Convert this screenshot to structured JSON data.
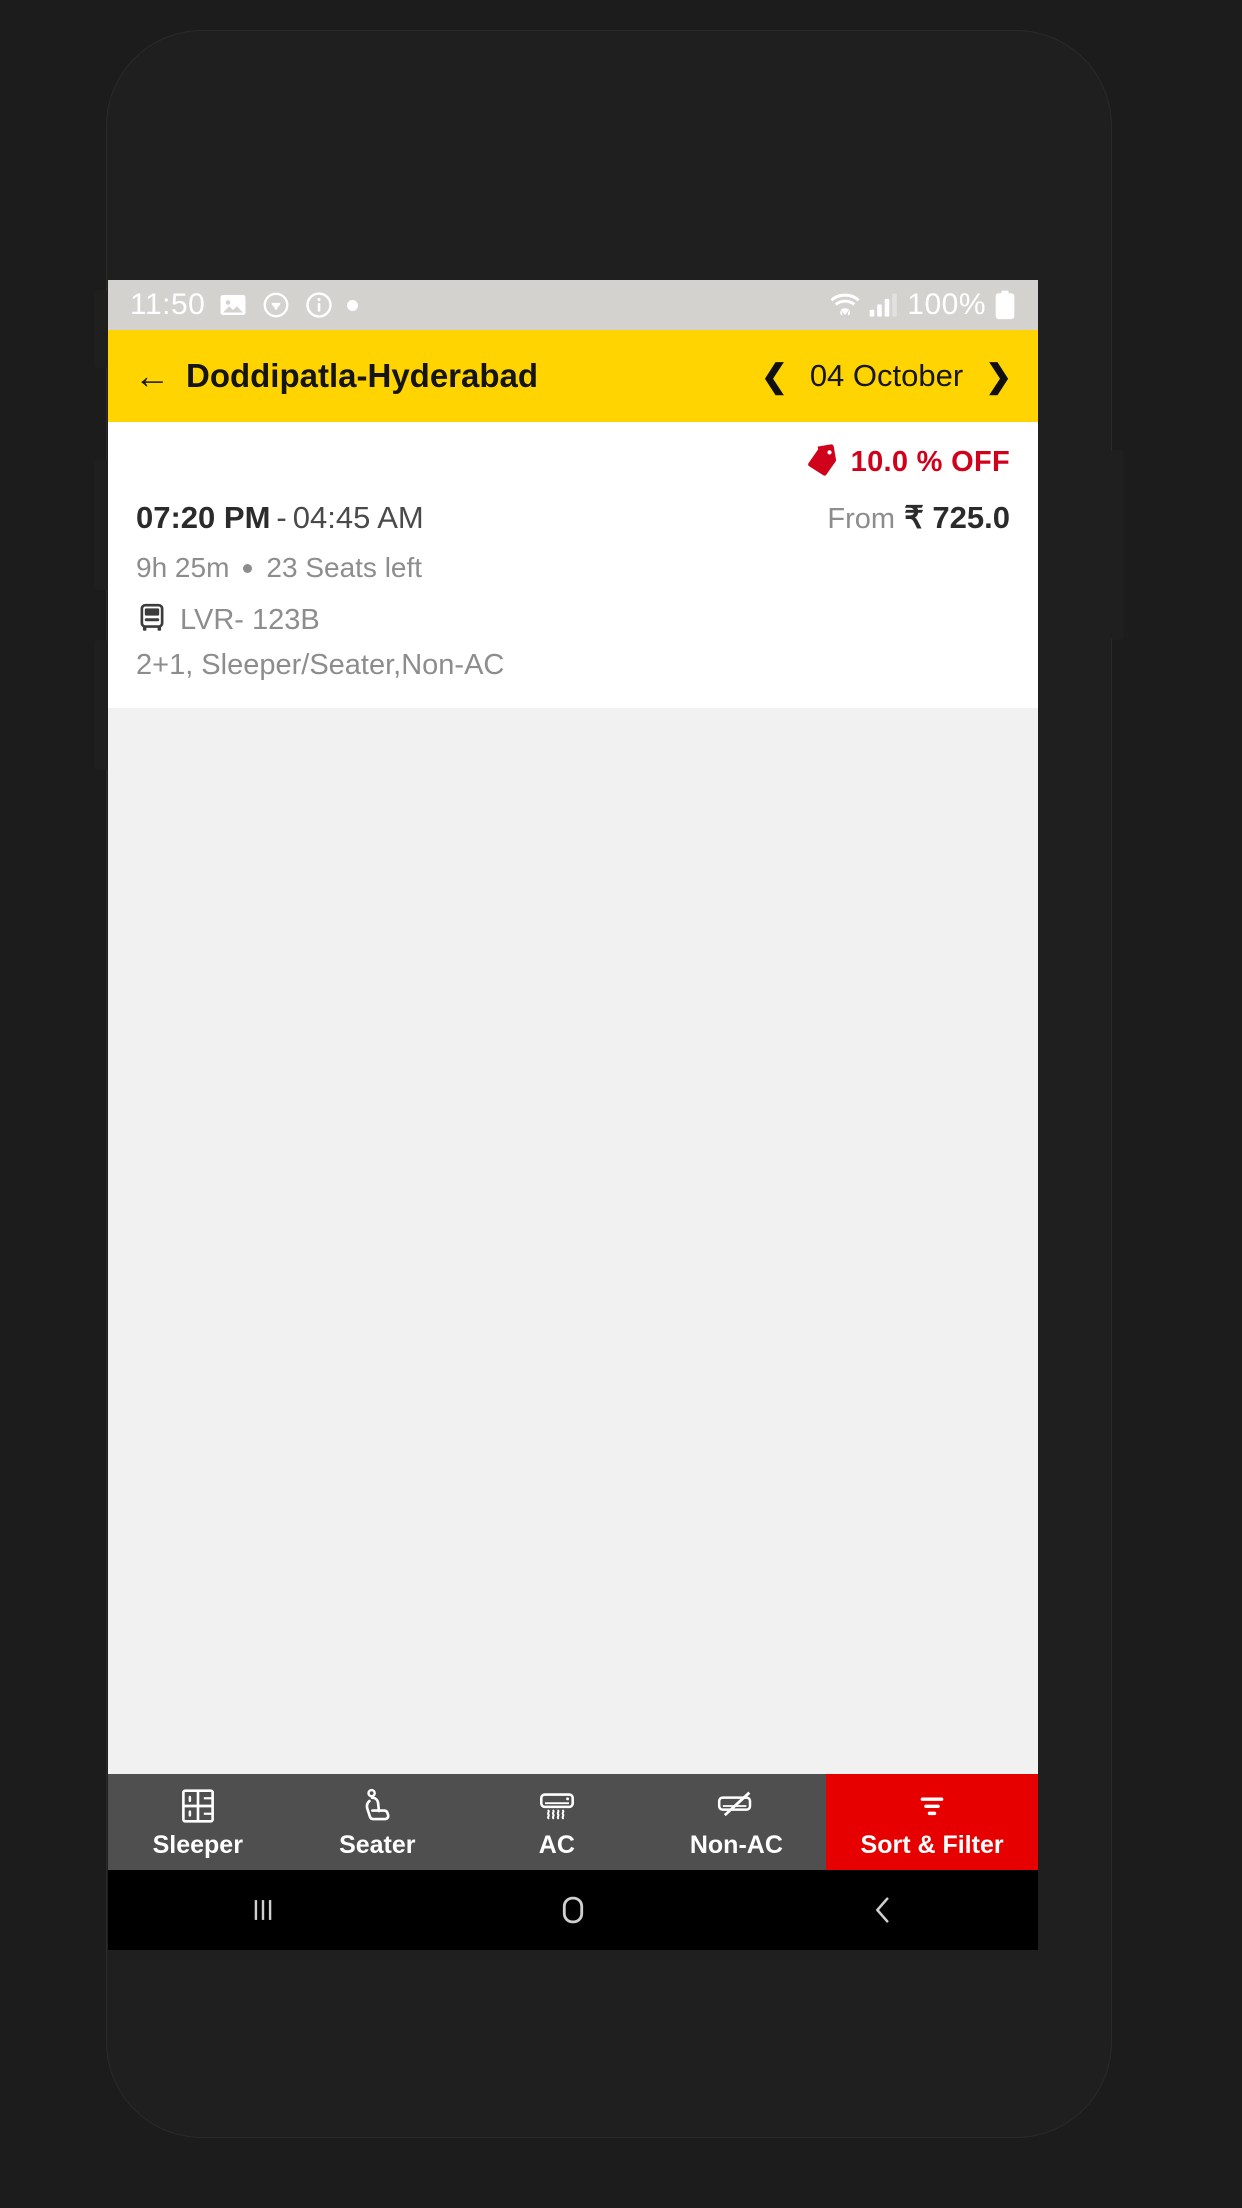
{
  "status_bar": {
    "time": "11:50",
    "icons": [
      "image-icon",
      "sync-circle-icon",
      "info-icon",
      "dot-icon"
    ],
    "wifi_icon": "wifi-icon",
    "signal_icon": "signal-bars-icon",
    "battery_text": "100%",
    "battery_icon": "battery-full-icon",
    "background": "#d4d2cf"
  },
  "app_bar": {
    "back_icon": "back-arrow-icon",
    "route_title": "Doddipatla-Hyderabad",
    "prev_icon": "chevron-left-icon",
    "date": "04 October",
    "next_icon": "chevron-right-icon",
    "background": "#ffd400"
  },
  "bus_card": {
    "offer_icon": "discount-tag-icon",
    "offer_text": "10.0 % OFF",
    "offer_color": "#d0021b",
    "departure_time": "07:20 PM",
    "time_separator": "-",
    "arrival_time": "04:45 AM",
    "price_prefix": "From",
    "price_amount": "₹ 725.0",
    "duration": "9h 25m",
    "seats_left": "23 Seats left",
    "bus_icon": "bus-icon",
    "bus_name": "LVR- 123B",
    "bus_config": "2+1, Sleeper/Seater,Non-AC"
  },
  "filter_bar": {
    "background": "#4f4f4f",
    "accent_color": "#e60000",
    "items": [
      {
        "label": "Sleeper",
        "icon": "sleeper-berth-icon",
        "accent": false
      },
      {
        "label": "Seater",
        "icon": "seat-icon",
        "accent": false
      },
      {
        "label": "AC",
        "icon": "ac-unit-icon",
        "accent": false
      },
      {
        "label": "Non-AC",
        "icon": "ac-off-icon",
        "accent": false
      },
      {
        "label": "Sort & Filter",
        "icon": "filter-lines-icon",
        "accent": true
      }
    ]
  },
  "nav_bar": {
    "recents_icon": "recents-icon",
    "home_icon": "home-icon",
    "back_icon": "back-icon"
  }
}
